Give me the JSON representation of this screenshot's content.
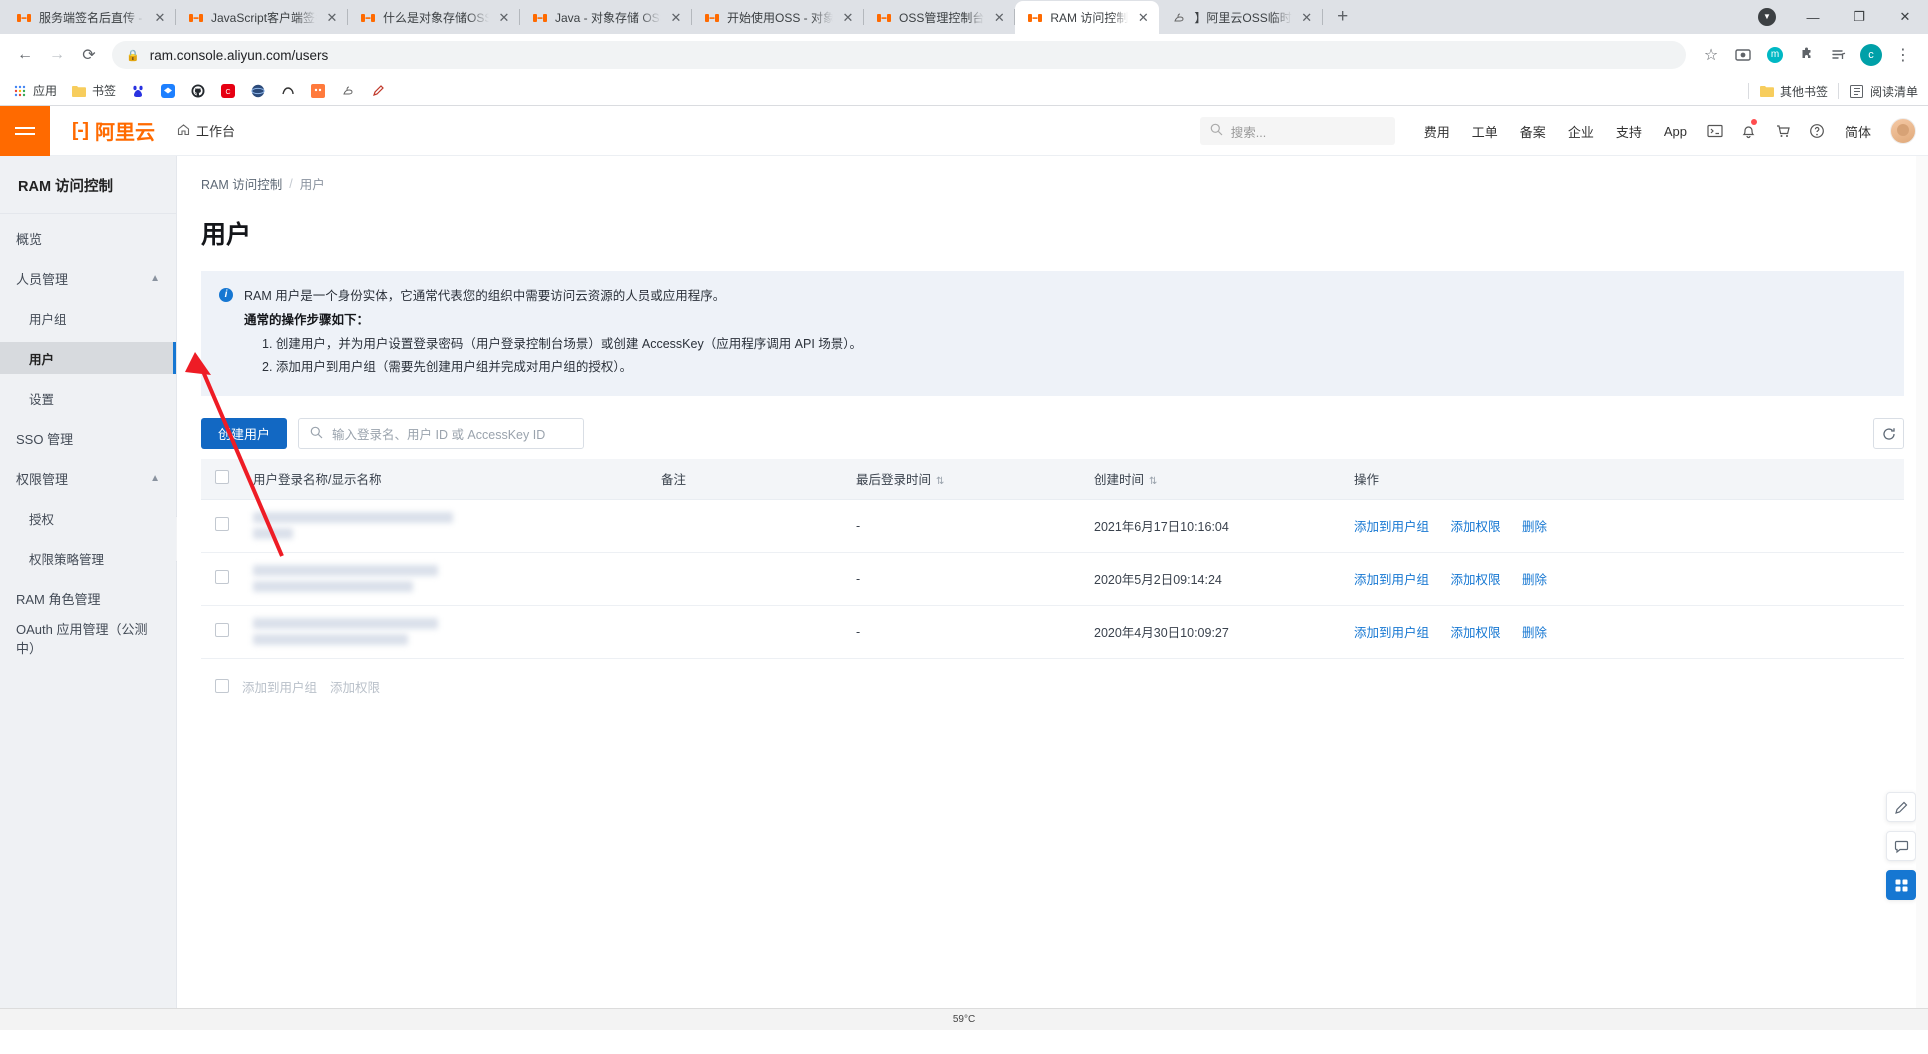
{
  "browser": {
    "tabs": [
      {
        "title": "服务端签名后直传 - 对象存",
        "favicon": "aliyun-icon",
        "active": false
      },
      {
        "title": "JavaScript客户端签名直传",
        "favicon": "aliyun-icon",
        "active": false
      },
      {
        "title": "什么是对象存储OSS - 对象",
        "favicon": "aliyun-icon",
        "active": false
      },
      {
        "title": "Java - 对象存储 OSS - 阿里",
        "favicon": "aliyun-icon",
        "active": false
      },
      {
        "title": "开始使用OSS - 对象存储 O",
        "favicon": "aliyun-icon",
        "active": false
      },
      {
        "title": "OSS管理控制台",
        "favicon": "aliyun-icon",
        "active": false
      },
      {
        "title": "RAM 访问控制",
        "favicon": "aliyun-icon",
        "active": true
      },
      {
        "title": "】阿里云OSS临时",
        "favicon": "rabbit-icon",
        "active": false
      }
    ],
    "new_tab_label": "+",
    "close_label": "✕",
    "window_controls": {
      "minimize": "—",
      "maximize": "❐",
      "close": "✕"
    },
    "nav": {
      "back": "←",
      "forward": "→",
      "reload": "⟳"
    },
    "omnibox": {
      "url": "ram.console.aliyun.com/users",
      "lock": "🔒"
    },
    "actions": {
      "bookmark_star": "☆",
      "profile_initial": "c",
      "menu": "⋮"
    },
    "bookmarks": [
      {
        "label": "应用",
        "icon": "apps-grid-icon"
      },
      {
        "label": "书签",
        "icon": "folder-icon"
      },
      {
        "label": "",
        "icon": "baidu-icon"
      },
      {
        "label": "",
        "icon": "juejin-icon"
      },
      {
        "label": "",
        "icon": "github-icon"
      },
      {
        "label": "",
        "icon": "csdn-icon"
      },
      {
        "label": "",
        "icon": "blue-globe-icon"
      },
      {
        "label": "",
        "icon": "segmentfault-icon"
      },
      {
        "label": "",
        "icon": "orange-square-icon"
      },
      {
        "label": "",
        "icon": "rabbit-icon"
      },
      {
        "label": "",
        "icon": "pen-icon"
      }
    ],
    "bookmarks_right": [
      {
        "label": "其他书签",
        "icon": "folder-icon"
      },
      {
        "label": "阅读清单",
        "icon": "reading-list-icon"
      }
    ]
  },
  "console_header": {
    "brand_mark": "[-]",
    "brand_text": "阿里云",
    "workbench": "工作台",
    "workbench_icon": "home-icon",
    "search_placeholder": "搜索...",
    "nav_links": [
      "费用",
      "工单",
      "备案",
      "企业",
      "支持",
      "App"
    ],
    "icons": [
      "terminal-icon",
      "bell-icon",
      "cart-icon",
      "help-icon"
    ],
    "language": "简体",
    "avatar": "user-avatar"
  },
  "sidebar": {
    "title": "RAM 访问控制",
    "items": [
      {
        "label": "概览",
        "level": 0,
        "active": false,
        "expandable": false
      },
      {
        "label": "人员管理",
        "level": 0,
        "active": false,
        "expandable": true
      },
      {
        "label": "用户组",
        "level": 1,
        "active": false,
        "expandable": false
      },
      {
        "label": "用户",
        "level": 1,
        "active": true,
        "expandable": false
      },
      {
        "label": "设置",
        "level": 1,
        "active": false,
        "expandable": false
      },
      {
        "label": "SSO 管理",
        "level": 0,
        "active": false,
        "expandable": false
      },
      {
        "label": "权限管理",
        "level": 0,
        "active": false,
        "expandable": true
      },
      {
        "label": "授权",
        "level": 1,
        "active": false,
        "expandable": false
      },
      {
        "label": "权限策略管理",
        "level": 1,
        "active": false,
        "expandable": false
      },
      {
        "label": "RAM 角色管理",
        "level": 0,
        "active": false,
        "expandable": false
      },
      {
        "label": "OAuth 应用管理（公测中）",
        "level": 0,
        "active": false,
        "expandable": false
      }
    ],
    "collapse_icon": "chevron-left-icon",
    "expand_icon": "chevron-up-icon"
  },
  "main": {
    "breadcrumb": {
      "root": "RAM 访问控制",
      "separator": "/",
      "current": "用户"
    },
    "page_title": "用户",
    "notice": {
      "icon": "info-icon",
      "line1": "RAM 用户是一个身份实体，它通常代表您的组织中需要访问云资源的人员或应用程序。",
      "line2": "通常的操作步骤如下：",
      "step1": "1. 创建用户，并为用户设置登录密码（用户登录控制台场景）或创建 AccessKey（应用程序调用 API 场景）。",
      "step2": "2. 添加用户到用户组（需要先创建用户组并完成对用户组的授权）。"
    },
    "toolbar": {
      "create_button": "创建用户",
      "search_placeholder": "输入登录名、用户 ID 或 AccessKey ID",
      "search_icon": "search-icon",
      "refresh_icon": "refresh-icon"
    },
    "table": {
      "columns": [
        {
          "key": "checkbox",
          "label": ""
        },
        {
          "key": "name",
          "label": "用户登录名称/显示名称",
          "sortable": false
        },
        {
          "key": "note",
          "label": "备注",
          "sortable": false
        },
        {
          "key": "last_login",
          "label": "最后登录时间",
          "sortable": true
        },
        {
          "key": "created",
          "label": "创建时间",
          "sortable": true
        },
        {
          "key": "ops",
          "label": "操作",
          "sortable": false
        }
      ],
      "sort_icon": "sort-updown-icon",
      "rows": [
        {
          "name": "",
          "name_redacted": true,
          "note": "",
          "last_login": "-",
          "created": "2021年6月17日10:16:04",
          "ops": [
            "添加到用户组",
            "添加权限",
            "删除"
          ]
        },
        {
          "name": "",
          "name_redacted": true,
          "note": "",
          "last_login": "-",
          "created": "2020年5月2日09:14:24",
          "ops": [
            "添加到用户组",
            "添加权限",
            "删除"
          ]
        },
        {
          "name": "",
          "name_redacted": true,
          "note": "",
          "last_login": "-",
          "created": "2020年4月30日10:09:27",
          "ops": [
            "添加到用户组",
            "添加权限",
            "删除"
          ]
        }
      ]
    },
    "bulk_actions": [
      "添加到用户组",
      "添加权限"
    ],
    "rail": [
      {
        "icon": "feedback-pen-icon",
        "accent": false
      },
      {
        "icon": "chat-icon",
        "accent": false
      },
      {
        "icon": "apps-grid-icon",
        "accent": true
      }
    ]
  },
  "taskbar": {
    "temp": "59°C"
  }
}
